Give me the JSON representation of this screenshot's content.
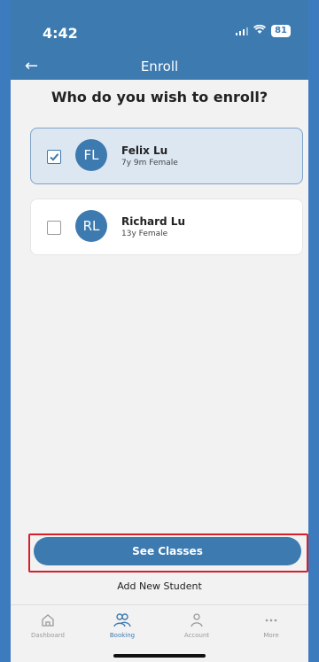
{
  "status_bar": {
    "time": "4:42",
    "battery": "81"
  },
  "header": {
    "back_icon": "back-arrow-icon",
    "title": "Enroll"
  },
  "heading": "Who do you wish to enroll?",
  "students": [
    {
      "initials": "FL",
      "name": "Felix Lu",
      "details": "7y 9m Female",
      "selected": true
    },
    {
      "initials": "RL",
      "name": "Richard Lu",
      "details": "13y Female",
      "selected": false
    }
  ],
  "primary_button": {
    "label": "See Classes"
  },
  "add_new_student": "Add New Student",
  "tab_bar": {
    "tabs": [
      {
        "label": "Dashboard",
        "icon": "home-icon",
        "active": false
      },
      {
        "label": "Booking",
        "icon": "people-icon",
        "active": true
      },
      {
        "label": "Account",
        "icon": "person-icon",
        "active": false
      },
      {
        "label": "More",
        "icon": "more-icon",
        "active": false
      }
    ]
  },
  "colors": {
    "brand": "#3d7ab0",
    "highlight": "#d61f2b",
    "selected_card": "#dde7f2"
  }
}
